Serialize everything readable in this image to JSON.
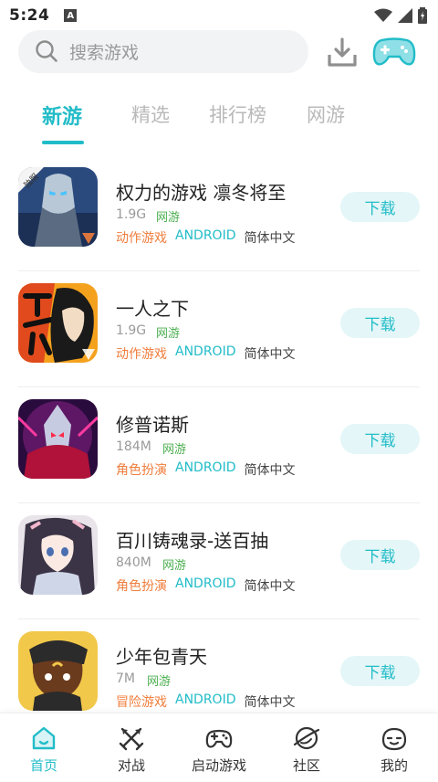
{
  "status": {
    "time": "5:24",
    "badge": "A"
  },
  "search": {
    "placeholder": "搜索游戏"
  },
  "tabs": [
    {
      "label": "新游",
      "active": true
    },
    {
      "label": "精选",
      "active": false
    },
    {
      "label": "排行榜",
      "active": false
    },
    {
      "label": "网游",
      "active": false
    }
  ],
  "games": [
    {
      "title": "权力的游戏 凛冬将至",
      "size": "1.9G",
      "type": "网游",
      "genre": "动作游戏",
      "platform": "ANDROID",
      "language": "简体中文",
      "button": "下载",
      "icon_badge": "独服"
    },
    {
      "title": "一人之下",
      "size": "1.9G",
      "type": "网游",
      "genre": "动作游戏",
      "platform": "ANDROID",
      "language": "简体中文",
      "button": "下载"
    },
    {
      "title": "修普诺斯",
      "size": "184M",
      "type": "网游",
      "genre": "角色扮演",
      "platform": "ANDROID",
      "language": "简体中文",
      "button": "下载"
    },
    {
      "title": "百川铸魂录-送百抽",
      "size": "840M",
      "type": "网游",
      "genre": "角色扮演",
      "platform": "ANDROID",
      "language": "简体中文",
      "button": "下载"
    },
    {
      "title": "少年包青天",
      "size": "7M",
      "type": "网游",
      "genre": "冒险游戏",
      "platform": "ANDROID",
      "language": "简体中文",
      "button": "下载"
    }
  ],
  "nav": [
    {
      "label": "首页",
      "icon": "home-icon",
      "active": true
    },
    {
      "label": "对战",
      "icon": "swords-icon",
      "active": false
    },
    {
      "label": "启动游戏",
      "icon": "gamepad-icon",
      "active": false
    },
    {
      "label": "社区",
      "icon": "planet-icon",
      "active": false
    },
    {
      "label": "我的",
      "icon": "face-icon",
      "active": false
    }
  ],
  "colors": {
    "accent": "#22bcc8",
    "genre": "#f07d3c",
    "netgame": "#4caf50",
    "dl_bg": "#e4f6f7"
  }
}
